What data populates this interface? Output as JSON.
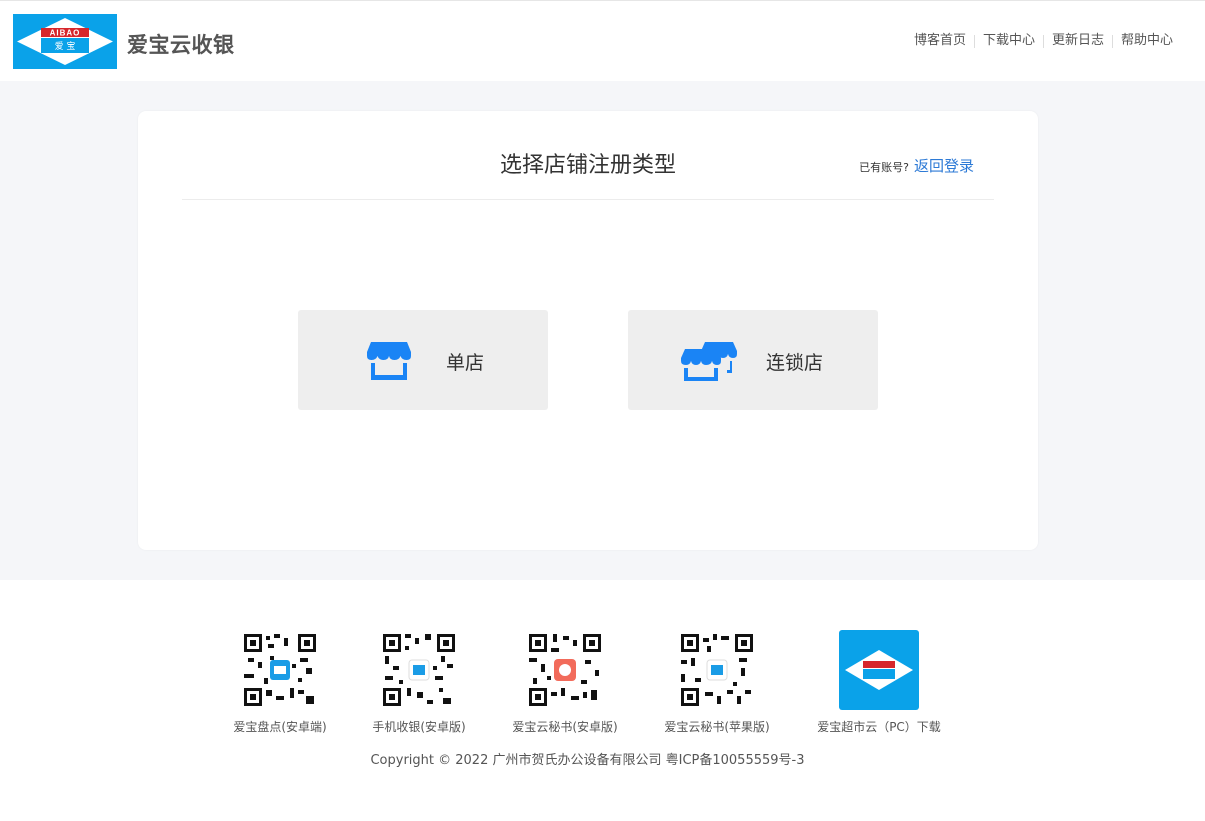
{
  "brand": {
    "logo_text_top": "AIBAO",
    "logo_text_bottom": "爱 宝",
    "name": "爱宝云收银",
    "logo_color": "#0aa2e9"
  },
  "nav": [
    {
      "label": "博客首页"
    },
    {
      "label": "下载中心"
    },
    {
      "label": "更新日志"
    },
    {
      "label": "帮助中心"
    }
  ],
  "card": {
    "title": "选择店铺注册类型",
    "login_question": "已有账号?",
    "login_link": "返回登录",
    "options": [
      {
        "label": "单店",
        "icon": "store-icon"
      },
      {
        "label": "连锁店",
        "icon": "chain-store-icon"
      }
    ],
    "accent_color": "#1a84f5"
  },
  "downloads": [
    {
      "caption": "爱宝盘点(安卓端)",
      "icon": "qr-code-icon"
    },
    {
      "caption": "手机收银(安卓版)",
      "icon": "qr-code-icon"
    },
    {
      "caption": "爱宝云秘书(安卓版)",
      "icon": "qr-code-icon"
    },
    {
      "caption": "爱宝云秘书(苹果版)",
      "icon": "qr-code-icon"
    },
    {
      "caption": "爱宝超市云（PC）下载",
      "icon": "aibao-logo-icon"
    }
  ],
  "footer": {
    "copyright": "Copyright © 2022 广州市贺氏办公设备有限公司 粤ICP备10055559号-3"
  }
}
